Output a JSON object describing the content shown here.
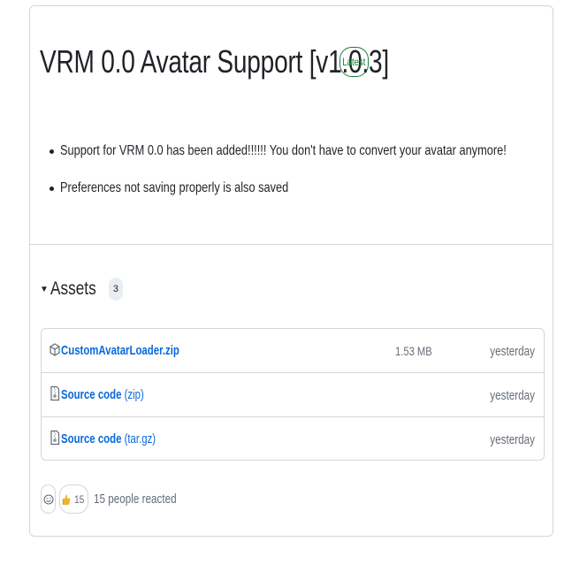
{
  "release": {
    "title": "VRM 0.0 Avatar Support [v1.0.3]",
    "badge": "Latest",
    "notes": [
      "Support for VRM 0.0 has been added!!!!!! You don't have to convert your avatar anymore!",
      "Preferences not saving properly is also saved"
    ]
  },
  "assets": {
    "title": "Assets",
    "count": "3",
    "items": [
      {
        "name": "CustomAvatarLoader.zip",
        "ext": "",
        "size": "1.53 MB",
        "date": "yesterday",
        "icon": "package-icon"
      },
      {
        "name": "Source code",
        "ext": "(zip)",
        "size": "",
        "date": "yesterday",
        "icon": "file-zip-icon"
      },
      {
        "name": "Source code",
        "ext": "(tar.gz)",
        "size": "",
        "date": "yesterday",
        "icon": "file-zip-icon"
      }
    ]
  },
  "reactions": {
    "emoji": "thumbs-up-icon",
    "count": "15",
    "summary": "15 people reacted"
  },
  "colors": {
    "link": "#0969da",
    "badge_green": "#1a7f37",
    "border": "#d0d7de",
    "muted": "#656d76"
  }
}
